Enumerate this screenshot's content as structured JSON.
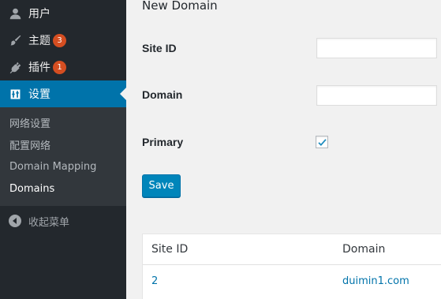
{
  "sidebar": {
    "items": [
      {
        "label": "用户",
        "icon": "user-icon"
      },
      {
        "label": "主题",
        "icon": "brush-icon",
        "badge": "3"
      },
      {
        "label": "插件",
        "icon": "plugin-icon",
        "badge": "1"
      },
      {
        "label": "设置",
        "icon": "settings-icon",
        "current": true
      }
    ],
    "submenu": [
      {
        "label": "网络设置"
      },
      {
        "label": "配置网络"
      },
      {
        "label": "Domain Mapping"
      },
      {
        "label": "Domains",
        "active": true
      }
    ],
    "collapse_label": "收起菜单"
  },
  "form": {
    "heading": "New Domain",
    "site_id_label": "Site ID",
    "site_id_value": "",
    "domain_label": "Domain",
    "domain_value": "",
    "primary_label": "Primary",
    "primary_checked": true,
    "save_label": "Save"
  },
  "table": {
    "columns": [
      "Site ID",
      "Domain"
    ],
    "rows": [
      {
        "site_id": "2",
        "domain": "duimin1.com"
      }
    ]
  },
  "colors": {
    "sidebar_bg": "#23282d",
    "submenu_bg": "#32373c",
    "accent": "#0073aa",
    "badge": "#d54e21"
  }
}
